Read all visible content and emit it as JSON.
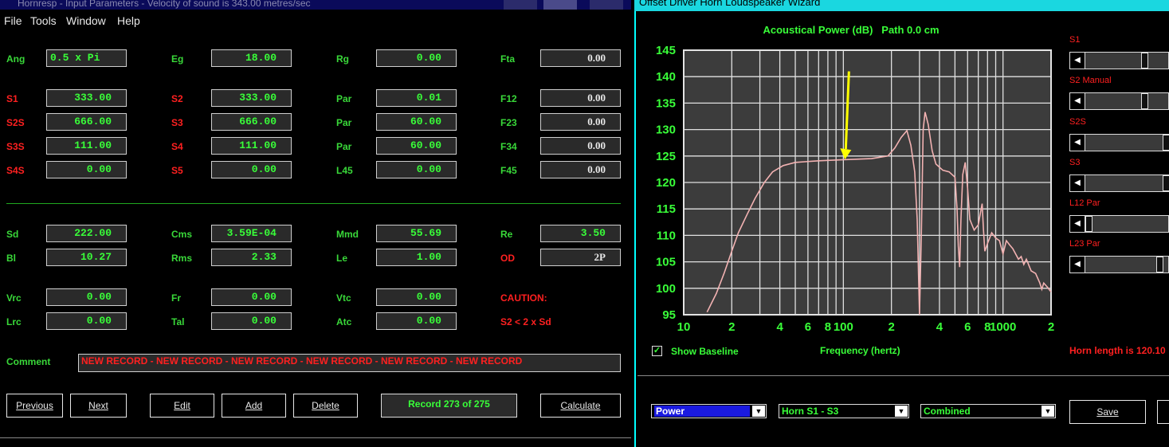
{
  "left_window": {
    "title": "Hornresp - Input Parameters - Velocity of sound is 343.00 metres/sec",
    "menu": [
      "File",
      "Tools",
      "Window",
      "Help"
    ],
    "fields": [
      {
        "label": "Ang",
        "value": "0.5 x Pi",
        "label_color": "green",
        "value_align": "left"
      },
      {
        "label": "Eg",
        "value": "18.00",
        "label_color": "green"
      },
      {
        "label": "Rg",
        "value": "0.00",
        "label_color": "green"
      },
      {
        "label": "Fta",
        "value": "0.00",
        "label_color": "green",
        "value_color": "white"
      },
      {
        "label": "S1",
        "value": "333.00",
        "label_color": "red"
      },
      {
        "label": "S2",
        "value": "333.00",
        "label_color": "red"
      },
      {
        "label": "Par",
        "value": "0.01",
        "label_color": "green"
      },
      {
        "label": "F12",
        "value": "0.00",
        "label_color": "green",
        "value_color": "white"
      },
      {
        "label": "S2S",
        "value": "666.00",
        "label_color": "red"
      },
      {
        "label": "S3",
        "value": "666.00",
        "label_color": "red"
      },
      {
        "label": "Par",
        "value": "60.00",
        "label_color": "green"
      },
      {
        "label": "F23",
        "value": "0.00",
        "label_color": "green",
        "value_color": "white"
      },
      {
        "label": "S3S",
        "value": "111.00",
        "label_color": "red"
      },
      {
        "label": "S4",
        "value": "111.00",
        "label_color": "red"
      },
      {
        "label": "Par",
        "value": "60.00",
        "label_color": "green"
      },
      {
        "label": "F34",
        "value": "0.00",
        "label_color": "green",
        "value_color": "white"
      },
      {
        "label": "S4S",
        "value": "0.00",
        "label_color": "red"
      },
      {
        "label": "S5",
        "value": "0.00",
        "label_color": "red"
      },
      {
        "label": "L45",
        "value": "0.00",
        "label_color": "green"
      },
      {
        "label": "F45",
        "value": "0.00",
        "label_color": "green",
        "value_color": "white"
      },
      {
        "label": "Sd",
        "value": "222.00",
        "label_color": "green"
      },
      {
        "label": "Cms",
        "value": "3.59E-04",
        "label_color": "green"
      },
      {
        "label": "Mmd",
        "value": "55.69",
        "label_color": "green"
      },
      {
        "label": "Re",
        "value": "3.50",
        "label_color": "green"
      },
      {
        "label": "Bl",
        "value": "10.27",
        "label_color": "green"
      },
      {
        "label": "Rms",
        "value": "2.33",
        "label_color": "green"
      },
      {
        "label": "Le",
        "value": "1.00",
        "label_color": "green"
      },
      {
        "label": "OD",
        "value": "2P",
        "label_color": "red",
        "value_color": "white"
      },
      {
        "label": "Vrc",
        "value": "0.00",
        "label_color": "green"
      },
      {
        "label": "Fr",
        "value": "0.00",
        "label_color": "green"
      },
      {
        "label": "Vtc",
        "value": "0.00",
        "label_color": "green"
      },
      {
        "label": "Lrc",
        "value": "0.00",
        "label_color": "green"
      },
      {
        "label": "Tal",
        "value": "0.00",
        "label_color": "green"
      },
      {
        "label": "Atc",
        "value": "0.00",
        "label_color": "green"
      }
    ],
    "caution": {
      "title": "CAUTION:",
      "message": "S2 < 2 x Sd"
    },
    "comment": {
      "label": "Comment",
      "value": "NEW RECORD - NEW RECORD - NEW RECORD - NEW RECORD - NEW RECORD - NEW RECORD"
    },
    "buttons": {
      "previous": "Previous",
      "next": "Next",
      "edit": "Edit",
      "add": "Add",
      "delete": "Delete",
      "calculate": "Calculate"
    },
    "record_status": "Record 273 of 275"
  },
  "right_window": {
    "title": "Offset Driver Horn Loudspeaker Wizard",
    "sliders": [
      {
        "label": "S1",
        "level": 0.72
      },
      {
        "label": "S2 Manual",
        "level": 0.72
      },
      {
        "label": "S2S",
        "level": 1.0
      },
      {
        "label": "S3",
        "level": 1.0
      },
      {
        "label": "L12 Par",
        "level": 0.0
      },
      {
        "label": "L23 Par",
        "level": 0.92
      }
    ],
    "show_baseline": {
      "label": "Show Baseline",
      "checked": true
    },
    "horn_length": "Horn length is 120.10",
    "dropdowns": [
      "Power",
      "Horn S1 - S3",
      "Combined"
    ],
    "save_button": "Save"
  },
  "colors": {
    "accent_green": "#39ff39",
    "label_red": "#ff2020",
    "chart_bg": "#3c3c3c",
    "curve": "#f2b2b2",
    "arrow": "#ffff00"
  },
  "chart_data": {
    "type": "line",
    "title": "Acoustical Power (dB)   Path 0.0 cm",
    "xlabel": "Frequency (hertz)",
    "ylabel": "",
    "x_scale": "log",
    "xlim": [
      10,
      2000
    ],
    "ylim": [
      95,
      145
    ],
    "yticks": [
      95,
      100,
      105,
      110,
      115,
      120,
      125,
      130,
      135,
      140,
      145
    ],
    "xtick_labels": [
      {
        "x": 10,
        "label": "10"
      },
      {
        "x": 20,
        "label": "2"
      },
      {
        "x": 40,
        "label": "4"
      },
      {
        "x": 60,
        "label": "6"
      },
      {
        "x": 80,
        "label": "8"
      },
      {
        "x": 100,
        "label": "100"
      },
      {
        "x": 200,
        "label": "2"
      },
      {
        "x": 400,
        "label": "4"
      },
      {
        "x": 600,
        "label": "6"
      },
      {
        "x": 800,
        "label": "8"
      },
      {
        "x": 1000,
        "label": "1000"
      },
      {
        "x": 2000,
        "label": "2"
      }
    ],
    "grid": true,
    "arrow_annotation": {
      "x": 100,
      "y_from": 141,
      "y_to": 124.5
    },
    "series": [
      {
        "values_xy": [
          [
            14,
            95.5
          ],
          [
            16,
            99
          ],
          [
            18,
            103
          ],
          [
            20,
            107
          ],
          [
            22,
            110.5
          ],
          [
            25,
            114
          ],
          [
            28,
            117
          ],
          [
            32,
            120
          ],
          [
            36,
            122
          ],
          [
            42,
            123.2
          ],
          [
            50,
            123.8
          ],
          [
            70,
            124.1
          ],
          [
            100,
            124.3
          ],
          [
            150,
            124.5
          ],
          [
            190,
            125
          ],
          [
            210,
            126.5
          ],
          [
            230,
            128.5
          ],
          [
            250,
            129.8
          ],
          [
            265,
            127
          ],
          [
            280,
            122
          ],
          [
            290,
            113
          ],
          [
            300,
            95
          ],
          [
            308,
            110
          ],
          [
            316,
            130
          ],
          [
            325,
            133.3
          ],
          [
            340,
            131
          ],
          [
            360,
            126
          ],
          [
            380,
            123.5
          ],
          [
            420,
            122.3
          ],
          [
            460,
            122
          ],
          [
            500,
            121
          ],
          [
            515,
            115
          ],
          [
            525,
            108
          ],
          [
            535,
            104
          ],
          [
            545,
            113
          ],
          [
            560,
            121.5
          ],
          [
            580,
            123.8
          ],
          [
            600,
            119
          ],
          [
            620,
            113
          ],
          [
            660,
            111
          ],
          [
            700,
            112
          ],
          [
            740,
            116
          ],
          [
            755,
            111
          ],
          [
            770,
            107
          ],
          [
            800,
            108.5
          ],
          [
            850,
            110.5
          ],
          [
            900,
            109.5
          ],
          [
            950,
            109
          ],
          [
            1000,
            106.5
          ],
          [
            1050,
            109
          ],
          [
            1100,
            108.2
          ],
          [
            1150,
            107.5
          ],
          [
            1250,
            105.5
          ],
          [
            1300,
            106
          ],
          [
            1350,
            104.5
          ],
          [
            1400,
            105.5
          ],
          [
            1500,
            103.3
          ],
          [
            1600,
            102.8
          ],
          [
            1700,
            101
          ],
          [
            1750,
            99.8
          ],
          [
            1800,
            101
          ],
          [
            1900,
            100.2
          ],
          [
            2000,
            99.3
          ]
        ]
      }
    ]
  }
}
